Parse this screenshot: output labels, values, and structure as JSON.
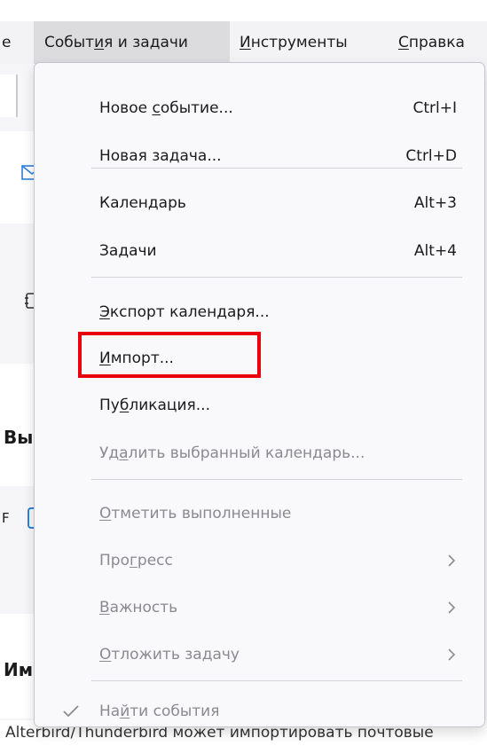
{
  "menubar": {
    "items": [
      {
        "label_before": "",
        "mnemonic": "",
        "label_after": "е"
      },
      {
        "label_before": "Событ",
        "mnemonic": "и",
        "label_after": "я и задачи"
      },
      {
        "label_before": "",
        "mnemonic": "И",
        "label_after": "нструменты"
      },
      {
        "label_before": "",
        "mnemonic": "С",
        "label_after": "правка"
      }
    ]
  },
  "menu": {
    "new_event": {
      "before": "Новое ",
      "mnemonic": "с",
      "after": "обытие...",
      "shortcut": "Ctrl+I"
    },
    "new_task": {
      "before": "Новая задача...",
      "mnemonic": "",
      "after": "",
      "shortcut": "Ctrl+D"
    },
    "calendar": {
      "before": "Календарь",
      "mnemonic": "",
      "after": "",
      "shortcut": "Alt+3"
    },
    "tasks": {
      "before": "Задачи",
      "mnemonic": "",
      "after": "",
      "shortcut": "Alt+4"
    },
    "export_calendar": {
      "before": "",
      "mnemonic": "Э",
      "after": "кспорт календаря..."
    },
    "import": {
      "before": "",
      "mnemonic": "И",
      "after": "мпорт..."
    },
    "publish": {
      "before": "Пу",
      "mnemonic": "б",
      "after": "ликация..."
    },
    "delete_calendar": {
      "before": "Уд",
      "mnemonic": "а",
      "after": "лить выбранный календарь..."
    },
    "mark_completed": {
      "before": "",
      "mnemonic": "О",
      "after": "тметить выполненные"
    },
    "progress": {
      "before": "Про",
      "mnemonic": "г",
      "after": "ресс"
    },
    "priority": {
      "before": "",
      "mnemonic": "В",
      "after": "ажность"
    },
    "postpone_task": {
      "before": "",
      "mnemonic": "О",
      "after": "тложить задачу"
    },
    "find_events": {
      "before": "На",
      "mnemonic": "й",
      "after": "ти события"
    }
  },
  "background": {
    "frag_vy": "Вы",
    "frag_f": "F",
    "frag_im": "Им",
    "bottom_text": "Alterbird/Thunderbird может импортировать почтовые"
  },
  "colors": {
    "highlight": "#e8000b",
    "disabled_text": "#8a8a8f",
    "accent_icon": "#2f7fd8"
  }
}
